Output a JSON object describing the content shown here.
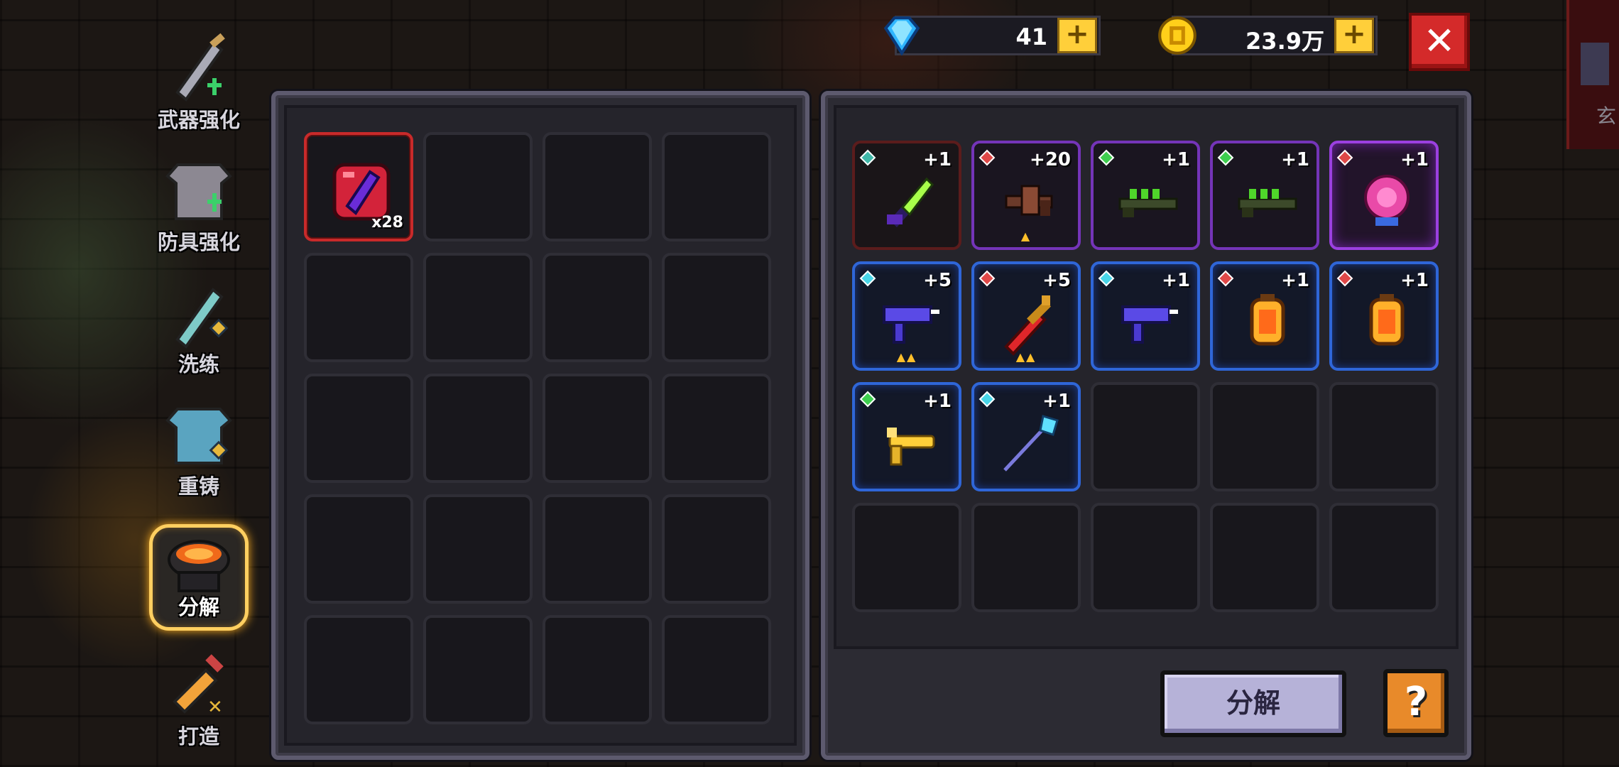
{
  "currency": {
    "gems": "41",
    "gold": "23.9万",
    "plus": "+",
    "close": "✕"
  },
  "menu": [
    {
      "label": "武器强化",
      "icon": "sword-upgrade-icon"
    },
    {
      "label": "防具强化",
      "icon": "armor-upgrade-icon"
    },
    {
      "label": "洗练",
      "icon": "weapon-reroll-icon"
    },
    {
      "label": "重铸",
      "icon": "armor-recast-icon"
    },
    {
      "label": "分解",
      "icon": "cauldron-icon",
      "active": true
    },
    {
      "label": "打造",
      "icon": "forge-hammer-icon"
    }
  ],
  "materials": {
    "item": {
      "icon": "red-crystal-material-icon",
      "count": "x28"
    }
  },
  "inventory": [
    {
      "level": "+1",
      "gem": "teal",
      "icon": "green-blade-icon",
      "rarity": "dark"
    },
    {
      "level": "+20",
      "gem": "red",
      "icon": "crossbow-icon",
      "rarity": "purple",
      "stars": "▲"
    },
    {
      "level": "+1",
      "gem": "green",
      "icon": "green-rifle-icon",
      "rarity": "purple"
    },
    {
      "level": "+1",
      "gem": "green",
      "icon": "green-rifle-icon",
      "rarity": "purple"
    },
    {
      "level": "+1",
      "gem": "red",
      "icon": "pink-flower-icon",
      "rarity": "purple2"
    },
    {
      "level": "+5",
      "gem": "cyan",
      "icon": "uzi-icon",
      "rarity": "blue",
      "stars": "▲▲"
    },
    {
      "level": "+5",
      "gem": "red",
      "icon": "red-sword-icon",
      "rarity": "blue",
      "stars": "▲▲"
    },
    {
      "level": "+1",
      "gem": "cyan",
      "icon": "uzi-icon",
      "rarity": "blue"
    },
    {
      "level": "+1",
      "gem": "red",
      "icon": "lantern-icon",
      "rarity": "blue"
    },
    {
      "level": "+1",
      "gem": "red",
      "icon": "lantern-icon",
      "rarity": "blue"
    },
    {
      "level": "+1",
      "gem": "green",
      "icon": "golden-pistol-icon",
      "rarity": "blue"
    },
    {
      "level": "+1",
      "gem": "cyan",
      "icon": "ice-spear-icon",
      "rarity": "blue"
    }
  ],
  "buttons": {
    "decompose": "分解",
    "help": "?"
  },
  "background": {
    "label": "玄"
  },
  "colors": {
    "gem_teal": "#3fb7a8",
    "gem_red": "#e04848",
    "gem_green": "#3ecf4f",
    "gem_cyan": "#48d6e8"
  }
}
